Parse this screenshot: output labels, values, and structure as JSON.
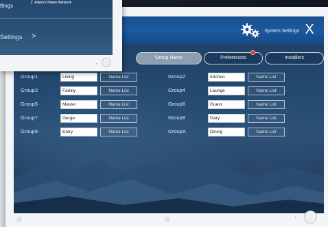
{
  "colors": {
    "title_bar": "#1b5aa0",
    "screen_bg": "#24496f",
    "active_tab": "#8d9eb0",
    "badge": "#e0282f"
  },
  "back_card": {
    "top_label": "ttings",
    "network_label": "Adam's Home Network",
    "settings_label": "Settings",
    "chevron_icon": "chevron-right-icon"
  },
  "header": {
    "icon": "gear-icon",
    "title": "System Settings",
    "close_icon": "close-icon",
    "close_label": "X"
  },
  "tabs": [
    {
      "label": "",
      "active": false,
      "badge": false
    },
    {
      "label": "Group Name",
      "active": true,
      "badge": false
    },
    {
      "label": "Preferences",
      "active": false,
      "badge": true
    },
    {
      "label": "Installers",
      "active": false,
      "badge": false
    }
  ],
  "groups_left": [
    {
      "label": "Group1",
      "value": "Living",
      "button": "Name List"
    },
    {
      "label": "Group3",
      "value": "Family",
      "button": "Name List"
    },
    {
      "label": "Group5",
      "value": "Master",
      "button": "Name List"
    },
    {
      "label": "Group7",
      "value": "Gerge",
      "button": "Name List"
    },
    {
      "label": "Group9",
      "value": "Entry",
      "button": "Name List"
    }
  ],
  "groups_right": [
    {
      "label": "Group2",
      "value": "Kitchen",
      "button": "Name List"
    },
    {
      "label": "Group4",
      "value": "Lounge",
      "button": "Name List"
    },
    {
      "label": "Group6",
      "value": "Guest",
      "button": "Name List"
    },
    {
      "label": "Group8",
      "value": "Gary",
      "button": "Name List"
    },
    {
      "label": "GroupA",
      "value": "Dining",
      "button": "Name List"
    }
  ]
}
